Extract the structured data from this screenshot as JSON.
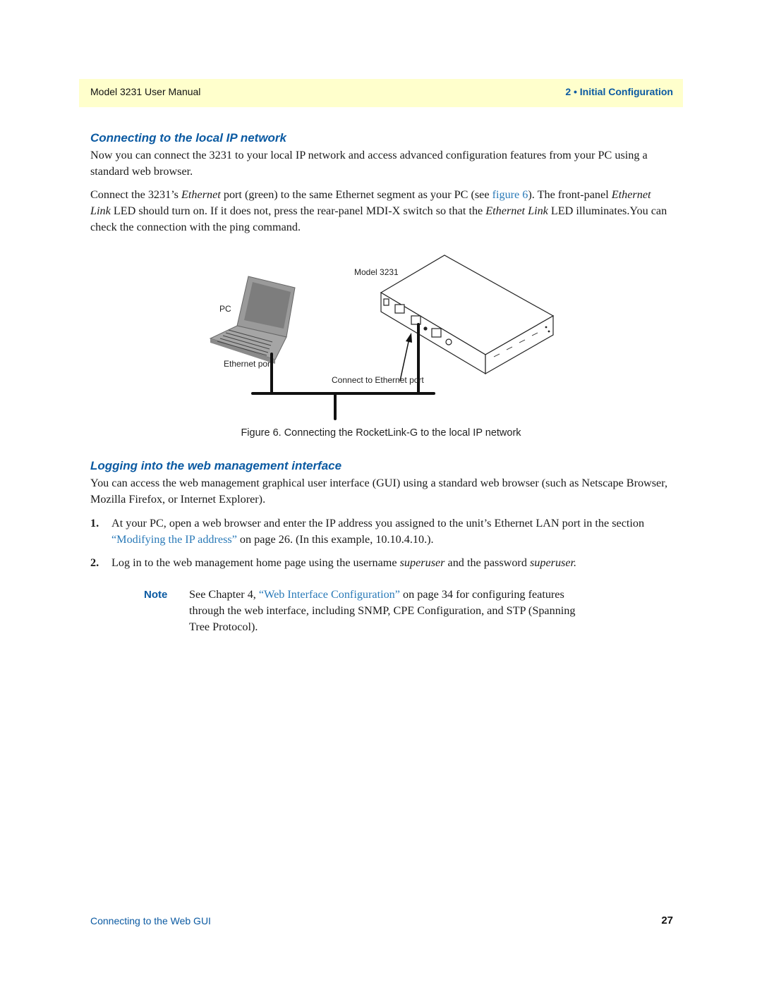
{
  "header": {
    "manual_title": "Model 3231 User Manual",
    "chapter": "2 • Initial Configuration"
  },
  "section1": {
    "heading": "Connecting to the local IP network",
    "para1": "Now you can connect the 3231 to your local IP network and access advanced configuration features from your PC using a standard web browser.",
    "para2": {
      "t1": "Connect the 3231’s ",
      "em1": "Ethernet",
      "t2": " port (green) to the same Ethernet segment as your PC (see ",
      "link": "figure 6",
      "t3": "). The front-panel ",
      "em2": "Ethernet Link",
      "t4": " LED should turn on. If it does not, press the rear-panel MDI-X switch so that the ",
      "em3": "Ethernet Link",
      "t5": " LED illuminates.You can check the connection with the ping command."
    }
  },
  "figure": {
    "label_device": "Model 3231",
    "label_pc": "PC",
    "label_pc_port": "Ethernet port",
    "label_device_port": "Connect to Ethernet port",
    "caption": "Figure 6. Connecting the RocketLink-G to the local IP network"
  },
  "section2": {
    "heading": "Logging into the web management interface",
    "para1": "You can access the web management graphical user interface (GUI) using a standard web browser (such as Netscape Browser, Mozilla Firefox, or Internet Explorer).",
    "steps": [
      {
        "num": "1.",
        "t1": "At your PC, open a web browser and enter the IP address you assigned to the unit’s Ethernet LAN port in the section ",
        "link": "“Modifying the IP address”",
        "t2": " on page 26. (In this example, 10.10.4.10.)."
      },
      {
        "num": "2.",
        "t1": "Log in to the web management home page using the username ",
        "em1": "superuser",
        "t2": " and the password ",
        "em2": "superuser."
      }
    ],
    "note": {
      "label": "Note",
      "t1": "See Chapter 4, ",
      "link": "“Web Interface Configuration”",
      "t2": " on page 34 for configuring features through the web interface, including SNMP, CPE Configuration, and STP (Spanning Tree Protocol)."
    }
  },
  "footer": {
    "section_title": "Connecting to the Web GUI",
    "page_number": "27"
  }
}
